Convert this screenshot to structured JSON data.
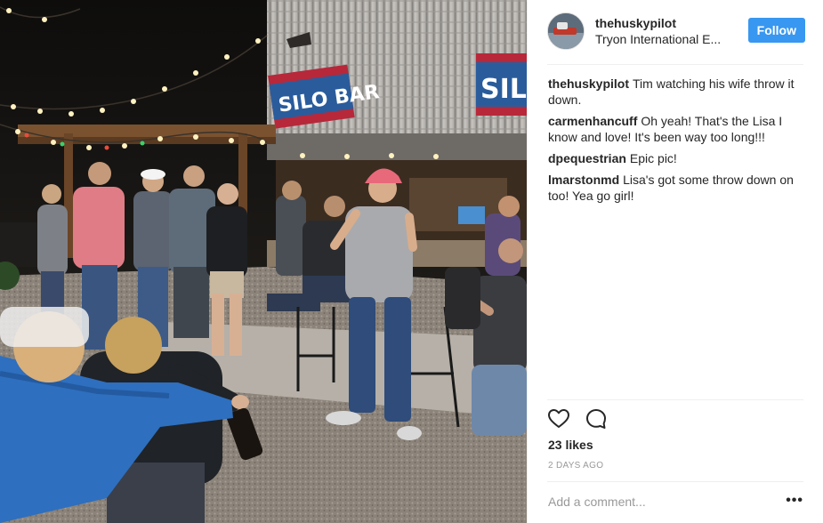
{
  "post": {
    "username": "thehuskypilot",
    "location": "Tryon International E...",
    "follow_label": "Follow",
    "photo_signs": {
      "left": "SILO BAR",
      "right": "SILO BAR"
    },
    "comments": [
      {
        "author": "thehuskypilot",
        "text": "Tim watching his wife throw it down."
      },
      {
        "author": "carmenhancuff",
        "text": "Oh yeah! That's the Lisa I know and love! It's been way too long!!!"
      },
      {
        "author": "dpequestrian",
        "text": "Epic pic!"
      },
      {
        "author": "lmarstonmd",
        "text": "Lisa's got some throw down on too! Yea go girl!"
      }
    ],
    "likes": "23 likes",
    "date": "2 DAYS AGO",
    "add_comment_placeholder": "Add a comment...",
    "more_label": "•••"
  },
  "icons": {
    "like": "heart-icon",
    "comment": "comment-bubble-icon",
    "more": "more-options-icon"
  },
  "colors": {
    "follow_button": "#3897f0",
    "text": "#262626",
    "muted": "#999999"
  }
}
